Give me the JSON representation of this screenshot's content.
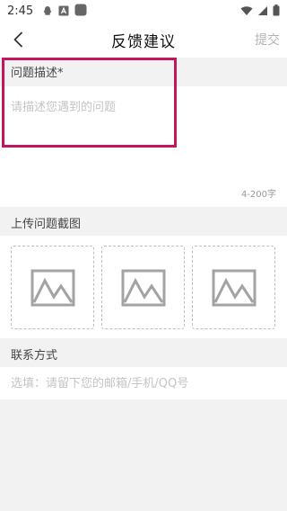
{
  "status_bar": {
    "time": "2:45"
  },
  "nav": {
    "title": "反馈建议",
    "submit_label": "提交"
  },
  "description": {
    "header": "问题描述*",
    "placeholder": "请描述您遇到的问题",
    "count_hint": "4-200字"
  },
  "upload": {
    "header": "上传问题截图",
    "slots": [
      "image-placeholder-icon",
      "image-placeholder-icon",
      "image-placeholder-icon"
    ]
  },
  "contact": {
    "header": "联系方式",
    "placeholder": "选填：请留下您的邮箱/手机/QQ号"
  },
  "colors": {
    "highlight": "#c2185b"
  }
}
